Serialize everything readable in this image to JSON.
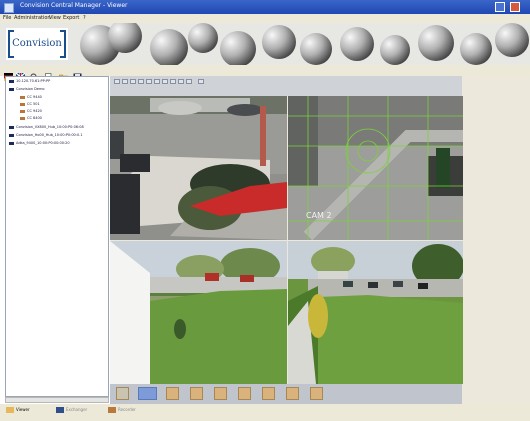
{
  "window": {
    "title": "Convision Central Manager - Viewer"
  },
  "menu": [
    "File",
    "Administration",
    "View",
    "Export",
    "?"
  ],
  "branding": {
    "logo_text": "Convision"
  },
  "tree": [
    {
      "label": "10.120.70.61:PP:PP",
      "level": 0
    },
    {
      "label": "Convision Demo",
      "level": 0
    },
    {
      "label": "CC 9440",
      "level": 1
    },
    {
      "label": "CC 501",
      "level": 1
    },
    {
      "label": "CC 9420",
      "level": 1
    },
    {
      "label": "CC 8400",
      "level": 1
    },
    {
      "label": "Convision_VX800_Hub_10:00:P0:06:08",
      "level": 0
    },
    {
      "label": "Convision_Ho00_Hub_10:00:P0:00:0.1",
      "level": 0
    },
    {
      "label": "Adka_9400_10:00:P0:00:00:20",
      "level": 0
    }
  ],
  "tabs": [
    {
      "label": "Viewer"
    },
    {
      "label": "Exchanger"
    },
    {
      "label": "Recorder"
    }
  ],
  "feeds": [
    {
      "name": "camera-1",
      "overlay": ""
    },
    {
      "name": "camera-2",
      "overlay": "CAM 2"
    },
    {
      "name": "camera-3",
      "overlay": ""
    },
    {
      "name": "camera-4",
      "overlay": ""
    }
  ],
  "colors": {
    "titlebar": "#2450c0",
    "menubar": "#ece9d8",
    "brand": "#184e8c",
    "panel_bg": "#ece9dc",
    "motion_grid": "#7cd13a"
  },
  "icons": {
    "toolbar": [
      "flag-de-icon",
      "flag-uk-icon",
      "search-icon",
      "new-document-icon",
      "open-folder-icon",
      "save-icon"
    ]
  }
}
